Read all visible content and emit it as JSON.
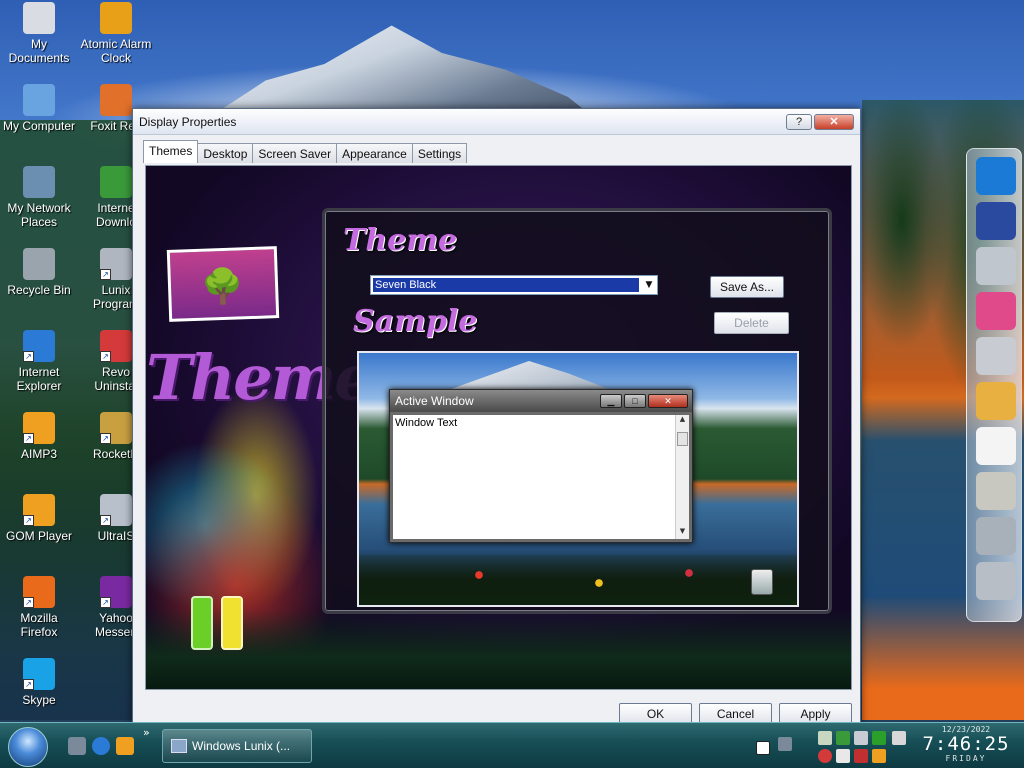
{
  "desktop": {
    "icons": [
      {
        "label": "My\nDocuments",
        "icon": "documents-icon",
        "color": "#d9dde3"
      },
      {
        "label": "Atomic Alarm\nClock",
        "icon": "alarm-clock-icon",
        "color": "#e8a019"
      },
      {
        "label": "My Computer",
        "icon": "computer-icon",
        "color": "#6aa4e0"
      },
      {
        "label": "Foxit Rea",
        "icon": "foxit-reader-icon",
        "color": "#e0702a"
      },
      {
        "label": "My Network\nPlaces",
        "icon": "network-icon",
        "color": "#6a8fb0"
      },
      {
        "label": "Interne\nDownlo",
        "icon": "internet-download-icon",
        "color": "#3a9a3a"
      },
      {
        "label": "Recycle Bin",
        "icon": "recycle-bin-icon",
        "color": "#9aa4ad"
      },
      {
        "label": "Lunix\nProgram",
        "icon": "lunix-program-icon",
        "color": "#b0b6c0"
      },
      {
        "label": "Internet\nExplorer",
        "icon": "internet-explorer-icon",
        "color": "#2a7ad6"
      },
      {
        "label": "Revo\nUninstal",
        "icon": "revo-uninstaller-icon",
        "color": "#d43a3a"
      },
      {
        "label": "AIMP3",
        "icon": "aimp3-icon",
        "color": "#f0a020"
      },
      {
        "label": "RocketD",
        "icon": "rocketdock-icon",
        "color": "#c8a040"
      },
      {
        "label": "GOM Player",
        "icon": "gom-player-icon",
        "color": "#f0a020"
      },
      {
        "label": "UltraIS",
        "icon": "ultraiso-icon",
        "color": "#b8c0cc"
      },
      {
        "label": "Mozilla\nFirefox",
        "icon": "firefox-icon",
        "color": "#e86a1a"
      },
      {
        "label": "Yahoo\nMessen",
        "icon": "yahoo-messenger-icon",
        "color": "#7a2aa0"
      },
      {
        "label": "Skype",
        "icon": "skype-icon",
        "color": "#19a3e6"
      }
    ]
  },
  "dialog": {
    "title": "Display Properties",
    "help_label": "?",
    "close_label": "✕",
    "tabs": [
      {
        "label": "Themes"
      },
      {
        "label": "Desktop"
      },
      {
        "label": "Screen Saver"
      },
      {
        "label": "Appearance"
      },
      {
        "label": "Settings"
      }
    ],
    "themes_banner": "Themes",
    "theme_heading": "Theme",
    "theme_select_value": "Seven Black",
    "save_as_label": "Save As...",
    "delete_label": "Delete",
    "sample_heading": "Sample",
    "preview": {
      "window_title": "Active Window",
      "window_text": "Window Text"
    },
    "ok_label": "OK",
    "cancel_label": "Cancel",
    "apply_label": "Apply"
  },
  "dock": {
    "items": [
      {
        "icon": "arch-linux-icon",
        "color": "#1a7ad6"
      },
      {
        "icon": "graphics-editor-icon",
        "color": "#2a4aa0"
      },
      {
        "icon": "gears-icon",
        "color": "#c0c6ce"
      },
      {
        "icon": "color-wheel-icon",
        "color": "#e04a8a"
      },
      {
        "icon": "orb-icon",
        "color": "#c8ccd2"
      },
      {
        "icon": "paint-palette-icon",
        "color": "#e8b040"
      },
      {
        "icon": "notepad-icon",
        "color": "#f4f4f4"
      },
      {
        "icon": "calculator-icon",
        "color": "#c8c8c0"
      },
      {
        "icon": "tools-icon",
        "color": "#a8b0ba"
      },
      {
        "icon": "trash-icon",
        "color": "#b8bec6"
      }
    ]
  },
  "taskbar": {
    "task_label": "Windows Lunix (...",
    "overflow_label": "»",
    "clock": {
      "date": "12/23/2022",
      "time": "7:46:25",
      "day": "FRIDAY"
    }
  }
}
